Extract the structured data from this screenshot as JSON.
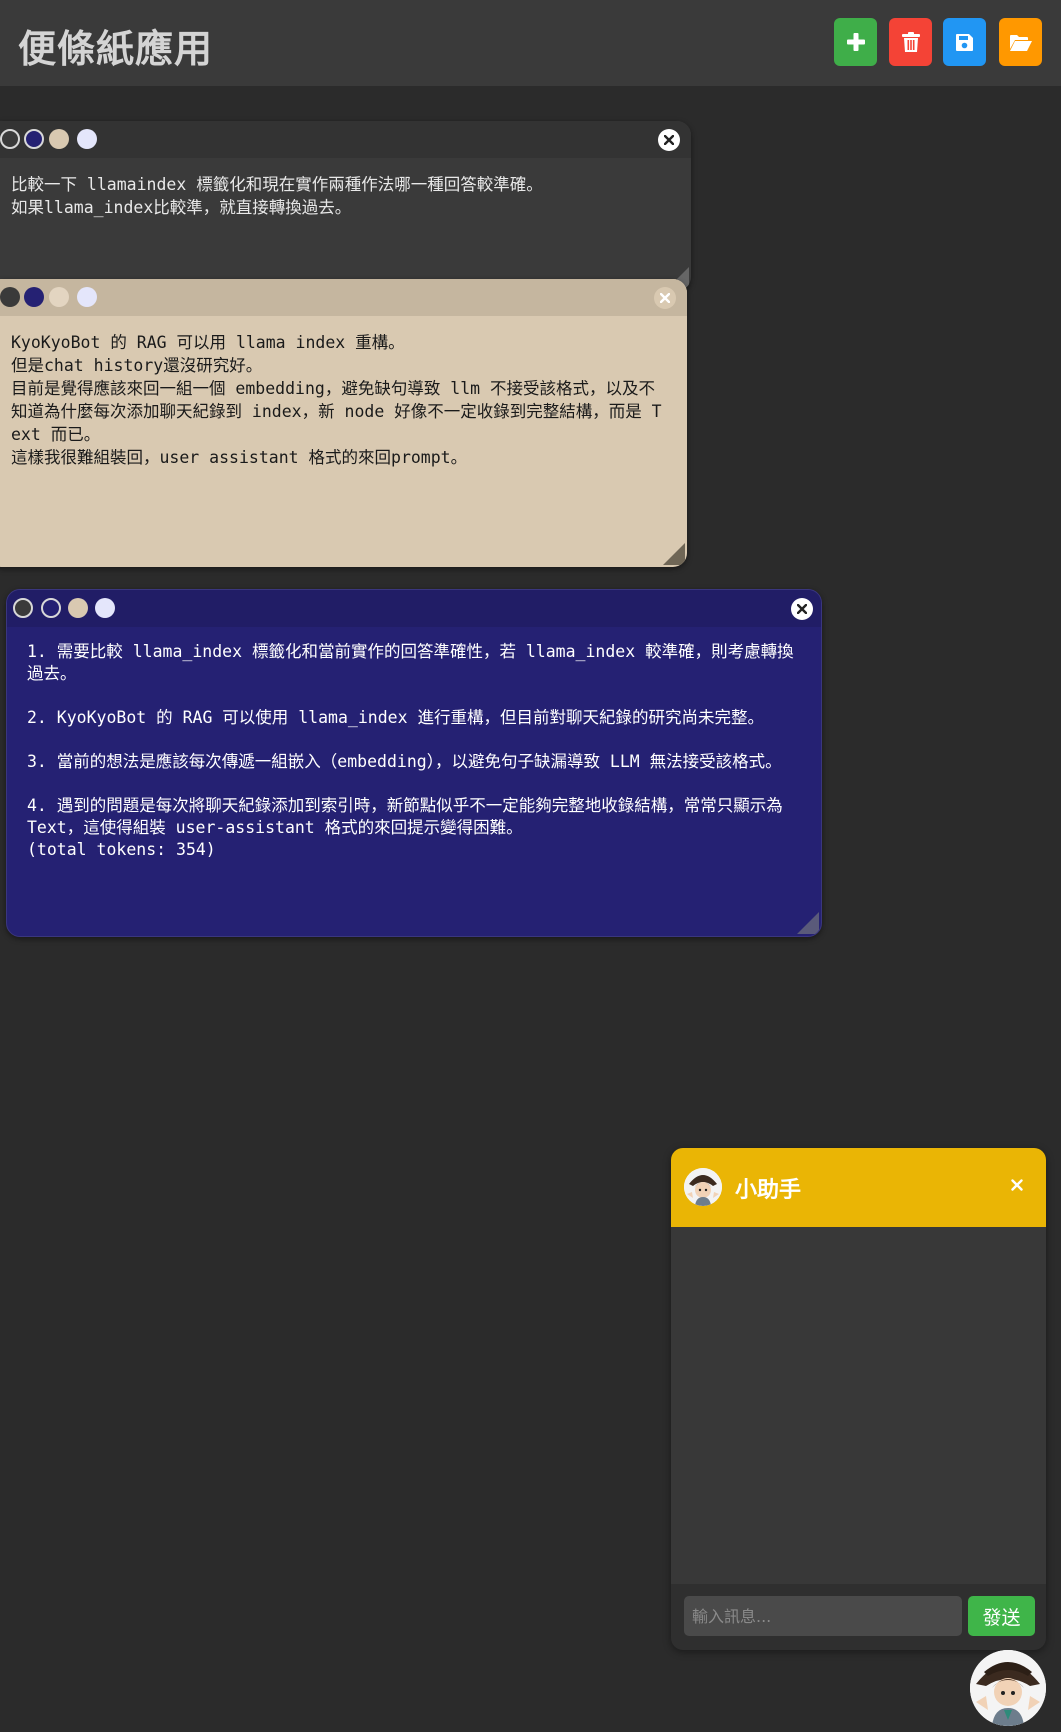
{
  "app": {
    "title": "便條紙應用"
  },
  "toolbar": {
    "buttons": [
      {
        "name": "add",
        "icon": "plus-icon",
        "color": "#3fae49"
      },
      {
        "name": "delete",
        "icon": "trash-icon",
        "color": "#f44336"
      },
      {
        "name": "save",
        "icon": "floppy-disk-icon",
        "color": "#2196f3"
      },
      {
        "name": "open",
        "icon": "folder-open-icon",
        "color": "#ff9800"
      }
    ]
  },
  "color_options": [
    "#3a3a3a",
    "#252173",
    "#d9c9b1",
    "#e4e6fb"
  ],
  "notes": [
    {
      "color": "#3a3a3a",
      "text_color": "#e8e8e8",
      "text": "比較一下 llamaindex 標籤化和現在實作兩種作法哪一種回答較準確。\n如果llama_index比較準，就直接轉換過去。"
    },
    {
      "color": "#d9c9b1",
      "text_color": "#1a1a1a",
      "text": "KyoKyoBot 的 RAG 可以用 llama index 重構。\n但是chat history還沒研究好。\n目前是覺得應該來回一組一個 embedding，避免缺句導致 llm 不接受該格式，以及不知道為什麼每次添加聊天紀錄到 index，新 node 好像不一定收錄到完整結構，而是 Text 而已。\n這樣我很難組裝回，user assistant 格式的來回prompt。"
    },
    {
      "color": "#252173",
      "text_color": "#ffffff",
      "text": "1. 需要比較 llama_index 標籤化和當前實作的回答準確性，若 llama_index 較準確，則考慮轉換過去。\n\n2. KyoKyoBot 的 RAG 可以使用 llama_index 進行重構，但目前對聊天紀錄的研究尚未完整。\n\n3. 當前的想法是應該每次傳遞一組嵌入（embedding），以避免句子缺漏導致 LLM 無法接受該格式。\n\n4. 遇到的問題是每次將聊天紀錄添加到索引時，新節點似乎不一定能夠完整地收錄結構，常常只顯示為 Text，這使得組裝 user-assistant 格式的來回提示變得困難。\n(total tokens: 354)"
    }
  ],
  "chat": {
    "title": "小助手",
    "header_color": "#eab505",
    "input_placeholder": "輸入訊息...",
    "send_label": "發送",
    "send_color": "#3fb549"
  }
}
